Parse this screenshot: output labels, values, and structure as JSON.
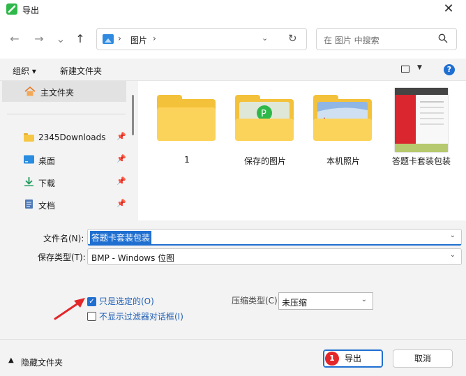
{
  "window": {
    "title": "导出",
    "close_glyph": "✕"
  },
  "nav": {
    "back_glyph": "←",
    "forward_glyph": "→",
    "recent_glyph": "⌄",
    "up_glyph": "↑",
    "breadcrumb": {
      "sep": "›",
      "location": "图片"
    },
    "dropdown_glyph": "⌄",
    "refresh_glyph": "↻"
  },
  "search": {
    "placeholder": "在 图片 中搜索"
  },
  "toolbar": {
    "organize": "组织 ▾",
    "new_folder": "新建文件夹",
    "view_dd": "▼",
    "help": "?"
  },
  "sidebar": {
    "home": "主文件夹",
    "pin_glyph": "📌",
    "items": [
      {
        "label": "2345Downloads",
        "icon": "folder-icon"
      },
      {
        "label": "桌面",
        "icon": "desktop-icon"
      },
      {
        "label": "下载",
        "icon": "download-icon"
      },
      {
        "label": "文档",
        "icon": "document-icon"
      }
    ]
  },
  "files": [
    {
      "label": "1",
      "type": "folder"
    },
    {
      "label": "保存的图片",
      "type": "folder"
    },
    {
      "label": "本机照片",
      "type": "folder"
    },
    {
      "label": "答题卡套装包装",
      "type": "image"
    }
  ],
  "form": {
    "filename_label": "文件名(N):",
    "filename_value": "答题卡套装包装",
    "type_label": "保存类型(T):",
    "type_value": "BMP - Windows 位图",
    "chevron": "⌄",
    "only_selected": "只是选定的(O)",
    "only_selected_checked": true,
    "no_filter_dialog": "不显示过滤器对话框(I)",
    "no_filter_dialog_checked": false,
    "compress_label": "压缩类型(C)",
    "compress_value": "未压缩",
    "check_glyph": "✓"
  },
  "footer": {
    "hide_folders": "隐藏文件夹",
    "hide_chevron": "▲",
    "export": "导出",
    "cancel": "取消",
    "step_badge": "1"
  },
  "colors": {
    "accent": "#1f6fd1",
    "folder": "#f3c13a",
    "badge": "#e3262a",
    "arrow": "#e3262a"
  }
}
